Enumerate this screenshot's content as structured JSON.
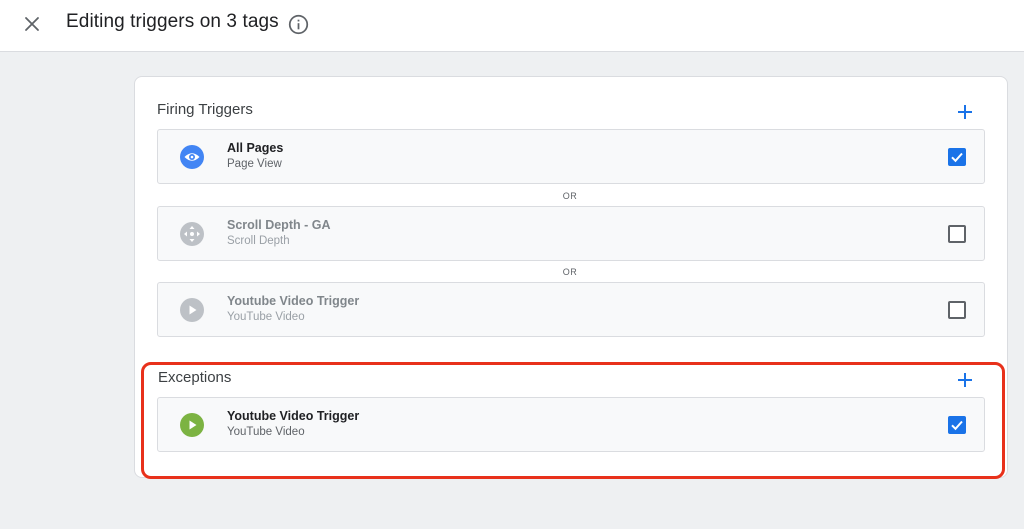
{
  "header": {
    "title": "Editing triggers on 3 tags",
    "close_icon": "close-icon",
    "info_icon": "info-icon"
  },
  "firing": {
    "title": "Firing Triggers",
    "add_icon": "plus-icon",
    "separator": "OR",
    "triggers": [
      {
        "name": "All Pages",
        "type": "Page View",
        "icon": "eye-icon",
        "icon_color": "#4285f4",
        "checked": true,
        "active": true
      },
      {
        "name": "Scroll Depth - GA",
        "type": "Scroll Depth",
        "icon": "move-arrows-icon",
        "icon_color": "#bdc1c6",
        "checked": false,
        "active": false
      },
      {
        "name": "Youtube Video Trigger",
        "type": "YouTube Video",
        "icon": "play-icon",
        "icon_color": "#bdc1c6",
        "checked": false,
        "active": false
      }
    ]
  },
  "exceptions": {
    "title": "Exceptions",
    "add_icon": "plus-icon",
    "triggers": [
      {
        "name": "Youtube Video Trigger",
        "type": "YouTube Video",
        "icon": "play-icon",
        "icon_color": "#7cb342",
        "checked": true,
        "active": true
      }
    ]
  },
  "colors": {
    "accent": "#1a73e8",
    "highlight": "#e8311b"
  }
}
